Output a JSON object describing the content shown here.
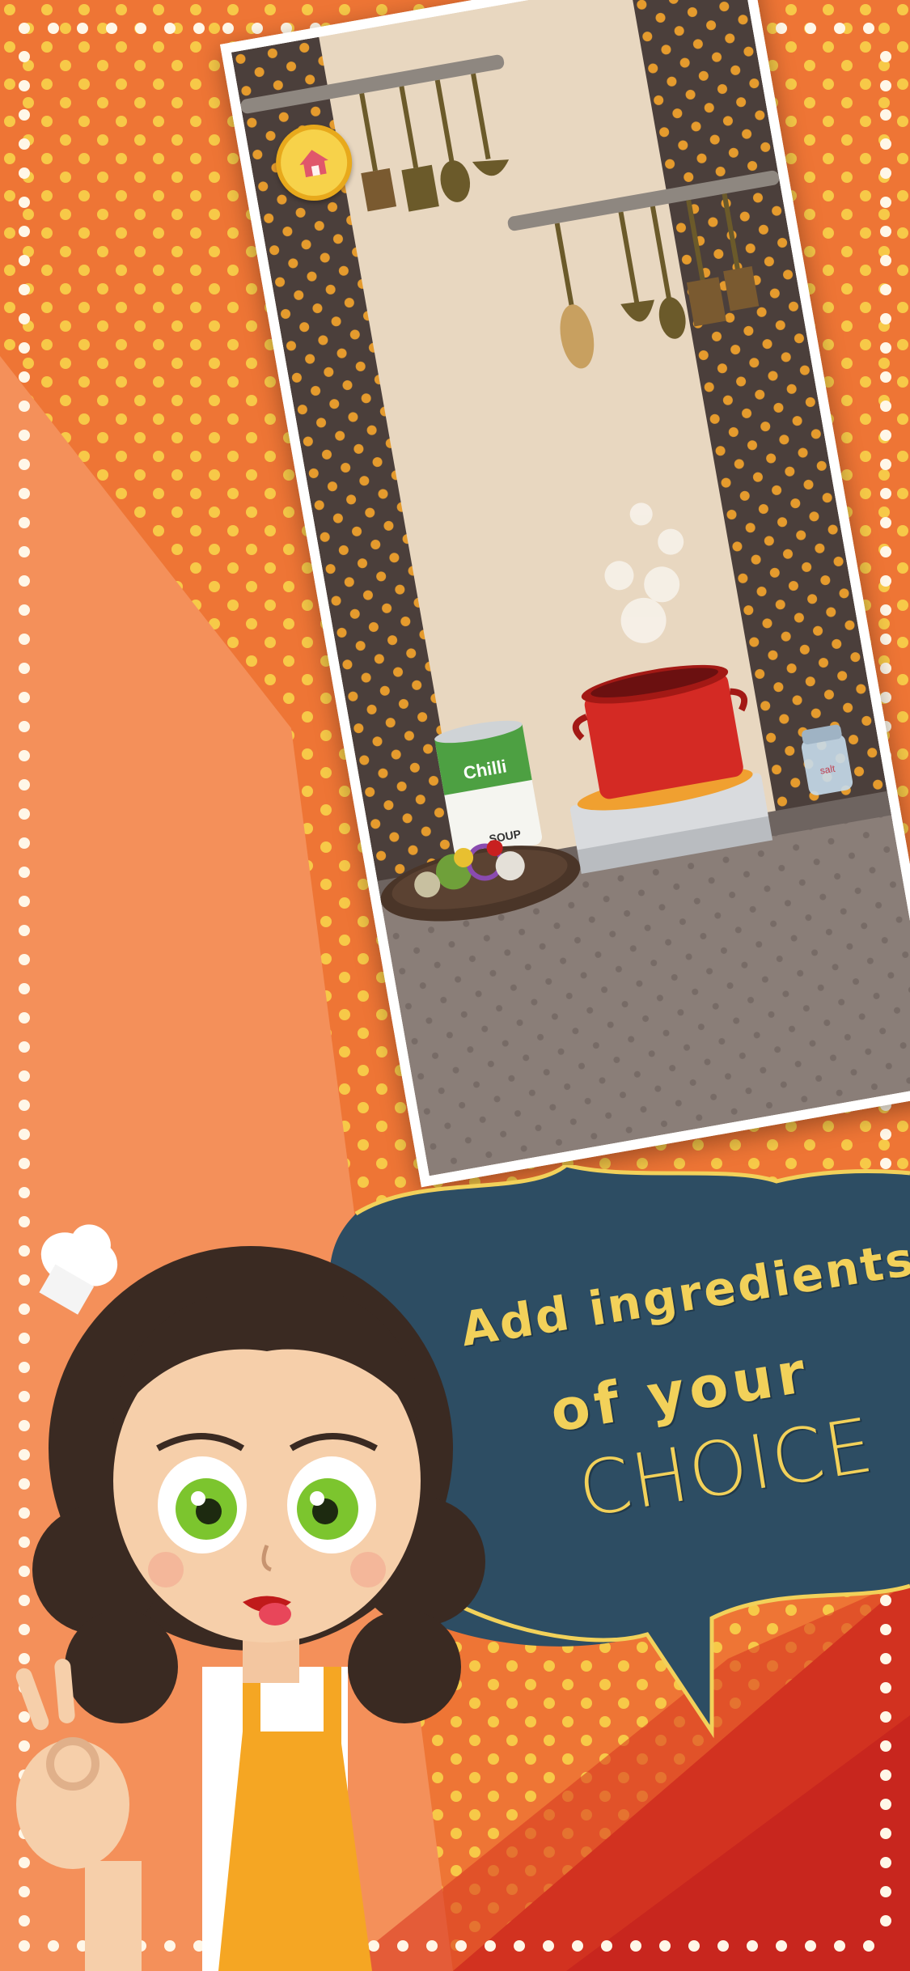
{
  "promo": {
    "caption_line1": "Add ingredients",
    "caption_line2": "of your",
    "caption_line3": "CHOICE"
  },
  "game_screen": {
    "can_label": "Chilli",
    "can_sublabel": "SOUP",
    "shaker_label": "salt"
  },
  "colors": {
    "background_orange": "#f07a3a",
    "bubble_navy": "#2d4d63",
    "caption_yellow": "#f2d15a",
    "wall_beige": "#e8d7c0",
    "pillar_brown": "#4a3f3b",
    "pot_red": "#d42a24"
  },
  "icons": [
    "home-icon",
    "chef-hat-icon"
  ]
}
